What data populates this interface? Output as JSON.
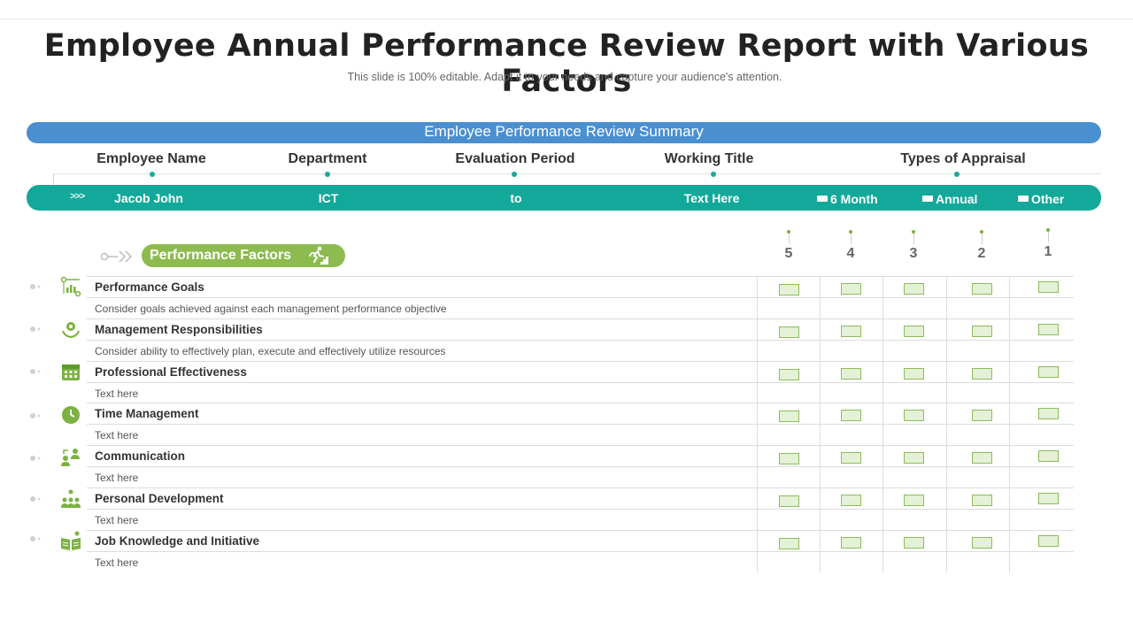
{
  "header": {
    "title": "Employee Annual Performance Review Report with Various Factors",
    "subtitle": "This slide is 100% editable. Adapt it to your needs and capture your audience's attention."
  },
  "summary": {
    "bar_label": "Employee Performance Review Summary",
    "fields": [
      {
        "label": "Employee Name",
        "value": "Jacob John"
      },
      {
        "label": "Department",
        "value": "ICT"
      },
      {
        "label": "Evaluation Period",
        "value": "to"
      },
      {
        "label": "Working Title",
        "value": "Text Here"
      },
      {
        "label": "Types of Appraisal",
        "value": ""
      }
    ],
    "appraisal_options": [
      "6 Month",
      "Annual",
      "Other"
    ],
    "arrow_glyph": ">>>"
  },
  "factors_section": {
    "pill_label": "Performance Factors",
    "ratings": [
      "5",
      "4",
      "3",
      "2",
      "1"
    ]
  },
  "factors": [
    {
      "name": "Performance Goals",
      "description": "Consider goals achieved against each management performance objective",
      "icon": "chart-settings-icon"
    },
    {
      "name": "Management Responsibilities",
      "description": "Consider ability to effectively plan, execute and effectively utilize resources",
      "icon": "hands-gear-icon"
    },
    {
      "name": "Professional Effectiveness",
      "description": "Text here",
      "icon": "calendar-icon"
    },
    {
      "name": "Time Management",
      "description": "Text here",
      "icon": "clock-icon"
    },
    {
      "name": "Communication",
      "description": "Text here",
      "icon": "people-exchange-icon"
    },
    {
      "name": "Personal Development",
      "description": "Text here",
      "icon": "team-growth-icon"
    },
    {
      "name": "Job Knowledge and Initiative",
      "description": "Text here",
      "icon": "book-idea-icon"
    }
  ],
  "colors": {
    "summary_bar": "#4a8fd0",
    "info_bar": "#12a99a",
    "accent_green": "#8dbb4f",
    "checkbox_fill": "#e4f1d6"
  }
}
